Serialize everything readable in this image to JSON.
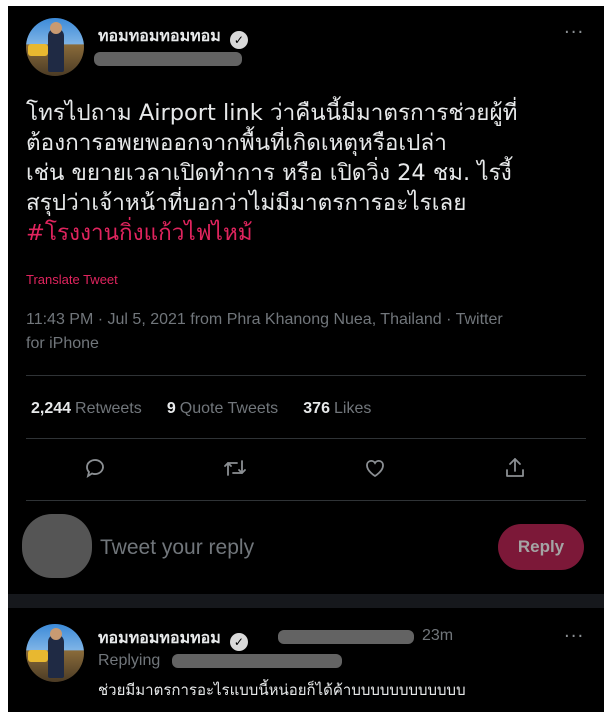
{
  "tweet": {
    "author_name": "ทอมทอมทอมทอม",
    "verified_icon": "verified-badge-icon",
    "more_icon": "more-horizontal-icon",
    "text_lines": [
      "โทรไปถาม Airport link ว่าคืนนี้มีมาตรการช่วยผู้ที่",
      "ต้องการอพยพออกจากพื้นที่เกิดเหตุหรือเปล่า",
      "เช่น ขยายเวลาเปิดทำการ หรือ เปิดวิ่ง 24 ชม. ไรงี้",
      "สรุปว่าเจ้าหน้าที่บอกว่าไม่มีมาตรการอะไรเลย"
    ],
    "hashtag": "#โรงงานกิ่งแก้วไฟไหม้",
    "translate_label": "Translate Tweet",
    "meta_line1": "11:43 PM · Jul 5, 2021 from Phra Khanong Nuea, Thailand · Twitter",
    "meta_line2": "for iPhone",
    "stats": {
      "retweets_count": "2,244",
      "retweets_label": "Retweets",
      "quotes_count": "9",
      "quotes_label": "Quote Tweets",
      "likes_count": "376",
      "likes_label": "Likes"
    },
    "actions": [
      "reply-icon",
      "retweet-icon",
      "like-icon",
      "share-icon"
    ]
  },
  "composer": {
    "placeholder": "Tweet your reply",
    "reply_button": "Reply"
  },
  "reply_tweet": {
    "author_name": "ทอมทอมทอมทอม",
    "time": "23m",
    "replying_label": "Replying",
    "text": "ช่วยมีมาตรการอะไรแบบนี้หน่อยก็ได้ค้าบบบบบบบบบบบบ"
  },
  "colors": {
    "background": "#000000",
    "hashtag": "#e0245e",
    "reply_button": "#7c1838",
    "muted_text": "#71767b"
  }
}
